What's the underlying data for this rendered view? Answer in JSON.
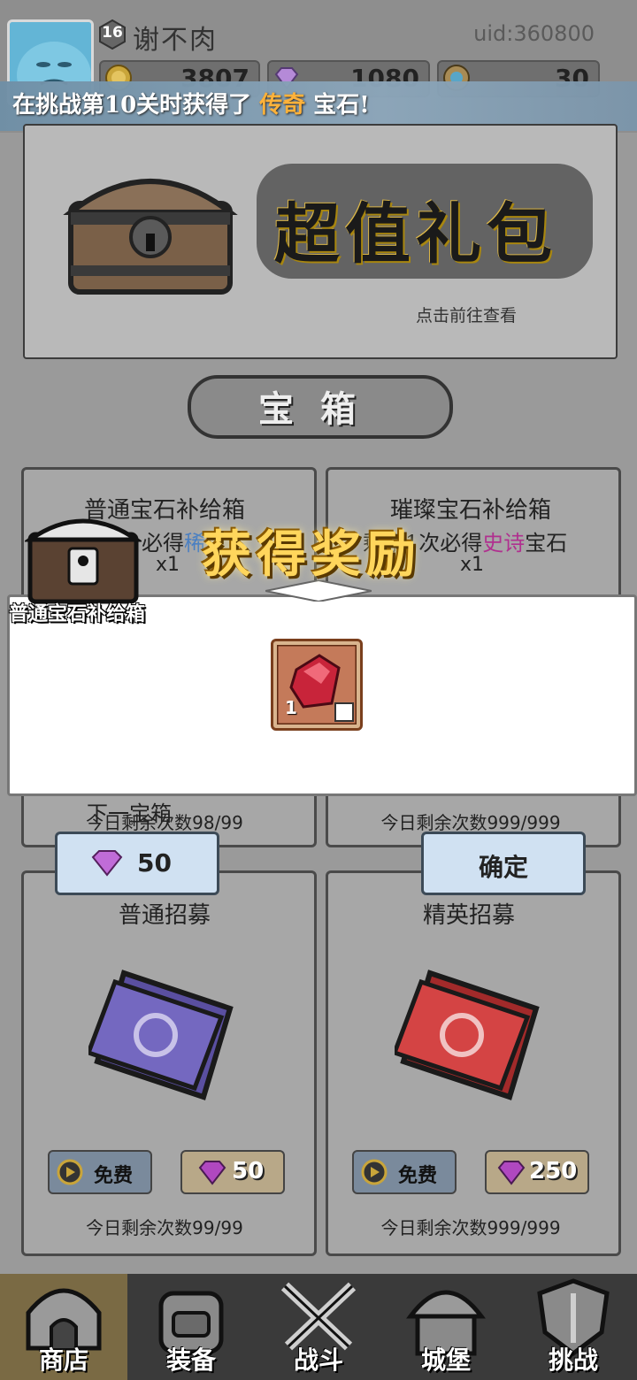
{
  "header": {
    "level": "16",
    "username": "谢不肉",
    "uid": "uid:360800",
    "resources": {
      "gold": "3807",
      "gems": "1080",
      "energy": "30"
    }
  },
  "banner": {
    "prefix": "在挑战第10关时获得了 ",
    "highlight": "传奇",
    "suffix": " 宝石!"
  },
  "gift": {
    "title": "超值礼包",
    "subtitle": "点击前往查看"
  },
  "section": {
    "title": "宝箱"
  },
  "chests": [
    {
      "name": "普通宝石补给箱",
      "line": "必得稀有宝石",
      "mult": "x1",
      "count": "今日剩余次数98/99"
    },
    {
      "name": "璀璨宝石补给箱",
      "line_prefix": "剩余1次必得",
      "line_highlight": "史诗",
      "line_suffix": "宝石",
      "mult": "x1",
      "count": "今日剩余次数999/999"
    }
  ],
  "reward_modal": {
    "title": "获得奖励",
    "box_label": "普通宝石补给箱",
    "item_count": "1",
    "next_button": {
      "text": "下一宝箱",
      "gem_value": "50"
    },
    "confirm_button": "确定"
  },
  "recruit": [
    {
      "title": "普通招募",
      "free": "免费",
      "cost": "50",
      "count": "今日剩余次数99/99",
      "color": "#5a4fa0"
    },
    {
      "title": "精英招募",
      "free": "免费",
      "cost": "250",
      "count": "今日剩余次数999/999",
      "color": "#c63a3a"
    }
  ],
  "nav": [
    {
      "label": "商店",
      "icon": "shop-icon"
    },
    {
      "label": "装备",
      "icon": "backpack-icon"
    },
    {
      "label": "战斗",
      "icon": "swords-icon"
    },
    {
      "label": "城堡",
      "icon": "castle-icon"
    },
    {
      "label": "挑战",
      "icon": "shield-icon"
    }
  ],
  "colors": {
    "highlight_legend": "#ffb23a",
    "epic": "#b0308f",
    "rare": "#4a7fc2",
    "gem": "#c92f5a"
  }
}
